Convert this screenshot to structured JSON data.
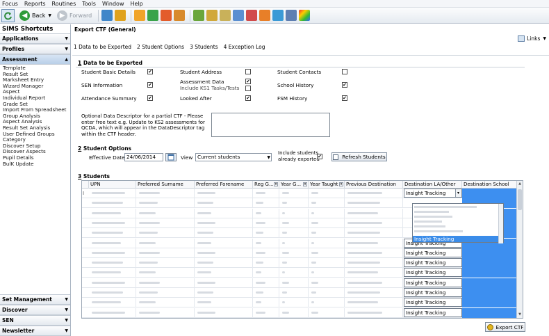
{
  "menu": [
    "Focus",
    "Reports",
    "Routines",
    "Tools",
    "Window",
    "Help"
  ],
  "toolbar": {
    "back": "Back",
    "forward": "Forward"
  },
  "sidebar": {
    "title": "SIMS Shortcuts",
    "sections_top": [
      "Applications",
      "Profiles",
      "Assessment"
    ],
    "items": [
      "Template",
      "Result Set",
      "Marksheet Entry",
      "Wizard Manager",
      "Aspect",
      "Individual Report",
      "Grade Set",
      "Import From Spreadsheet",
      "Group Analysis",
      "Aspect Analysis",
      "Result Set Analysis",
      "User Defined Groups",
      "Category",
      "Discover Setup",
      "Discover Aspects",
      "Pupil Details",
      "BulK Update"
    ],
    "sections_bottom": [
      "Set Management",
      "Discover",
      "SEN",
      "Newsletter"
    ]
  },
  "main": {
    "title": "Export CTF (General)",
    "links": "Links",
    "steps": [
      "1 Data to be Exported",
      "2 Student Options",
      "3 Students",
      "4 Exception Log"
    ],
    "section1": {
      "num": "1",
      "title": "Data to be Exported",
      "fields": [
        {
          "label": "Student Basic Details",
          "checked": true
        },
        {
          "label": "SEN Information",
          "checked": true
        },
        {
          "label": "Attendance Summary",
          "checked": true
        },
        {
          "label": "Student Address",
          "checked": false
        },
        {
          "label": "Assessment Data",
          "checked": true
        },
        {
          "label": "Include KS1 Tasks/Tests",
          "checked": false
        },
        {
          "label": "Looked After",
          "checked": true
        },
        {
          "label": "Student Contacts",
          "checked": false
        },
        {
          "label": "School History",
          "checked": true
        },
        {
          "label": "FSM History",
          "checked": true
        }
      ],
      "descriptor_text": "Optional Data Descriptor for a partial CTF - Please enter free text e.g. Update to KS2 assessments for QCDA, which will appear in the DataDescriptor tag within the CTF header."
    },
    "section2": {
      "num": "2",
      "title": "Student Options",
      "effective_date_label": "Effective Date",
      "effective_date": "24/06/2014",
      "view_label": "View",
      "view_value": "Current students",
      "include_label": "Include students already exported",
      "include_checked": true,
      "refresh_label": "Refresh Students"
    },
    "section3": {
      "num": "3",
      "title": "Students",
      "columns": [
        "UPN",
        "Preferred Surname",
        "Preferred Forename",
        "Reg G...",
        "Year G...",
        "Year Taught",
        "Previous Destination",
        "Destination LA/Other",
        "Destination School"
      ],
      "destination_value": "Insight Tracking",
      "dropdown_selected": "Insight Tracking"
    },
    "export_label": "Export CTF"
  }
}
